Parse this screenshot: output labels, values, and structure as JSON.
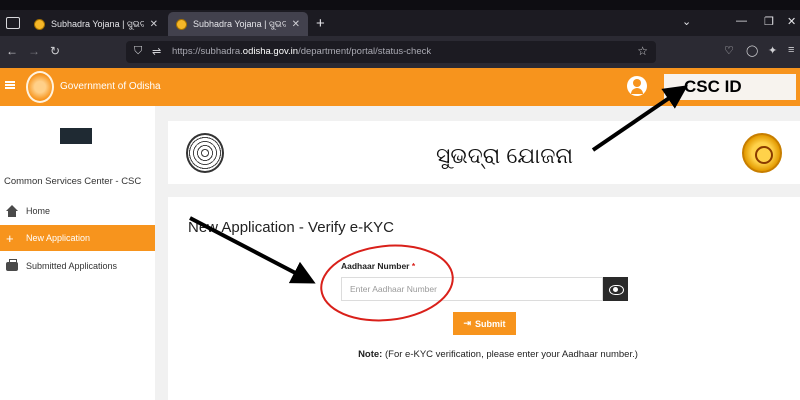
{
  "browser": {
    "tabs": [
      {
        "title": "Subhadra Yojana | ସୁଭଦ୍ରା ଯୋଜନା",
        "active": false
      },
      {
        "title": "Subhadra Yojana | ସୁଭଦ୍ରା ଯୋଜନା",
        "active": true
      }
    ],
    "new_tab_label": "+",
    "url_prefix": "https://subhadra.",
    "url_domain": "odisha.gov.in",
    "url_path": "/department/portal/status-check"
  },
  "header": {
    "org_name": "Government of Odisha",
    "user_label": "CSC ID",
    "accent": "#f7941d"
  },
  "sidebar": {
    "title": "Common Services Center - CSC",
    "items": [
      {
        "label": "Home",
        "icon": "home-icon",
        "active": false
      },
      {
        "label": "New Application",
        "icon": "plus-icon",
        "active": true
      },
      {
        "label": "Submitted Applications",
        "icon": "briefcase-icon",
        "active": false
      }
    ]
  },
  "brand": {
    "scheme_title": "ସୁଭଦ୍ରା ଯୋଜନା"
  },
  "form": {
    "title": "New Application - Verify e-KYC",
    "aadhaar_label": "Aadhaar Number",
    "required_mark": "*",
    "aadhaar_placeholder": "Enter Aadhaar Number",
    "submit_label": "Submit",
    "note_prefix": "Note:",
    "note_text": " (For e-KYC verification, please enter your Aadhaar number.)"
  }
}
